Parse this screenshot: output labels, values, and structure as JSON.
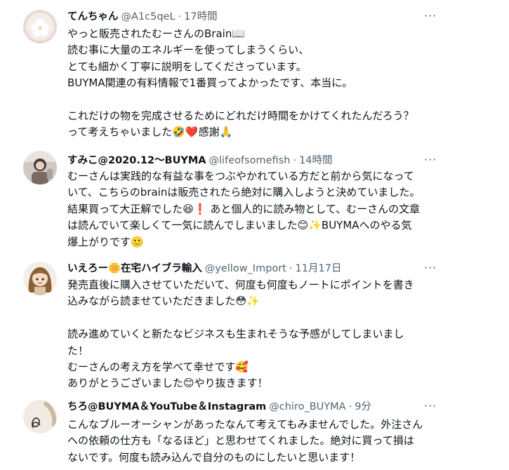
{
  "tweets": [
    {
      "name": "てんちゃん",
      "handle": "@A1c5qeL",
      "time": "17時間",
      "lines": [
        "やっと販売されたむーさんのBrain📖",
        "読む事に大量のエネルギーを使ってしまうくらい、",
        "とても細かく丁寧に説明をしてくださっています。",
        "BUYMA関連の有料情報で1番買ってよかったです、本当に。",
        "",
        "これだけの物を完成させるためにどれだけ時間をかけてくれたんだろう？",
        "って考えちゃいました🤣❤️感謝🙏"
      ]
    },
    {
      "name": "すみこ@2020.12〜BUYMA",
      "handle": "@lifeofsomefish",
      "time": "14時間",
      "lines": [
        "むーさんは実践的な有益な事をつぶやかれている方だと前から気になって",
        "いて、こちらのbrainは販売されたら絶対に購入しようと決めていました。",
        "結果買って大正解でした😆❗ あと個人的に読み物として、むーさんの文章",
        "は読んでいて楽しくて一気に読んでしまいました😊✨BUYMAへのやる気",
        "爆上がりです🙂"
      ]
    },
    {
      "name": "いえろー🌼在宅ハイブラ輸入",
      "handle": "@yellow_Import",
      "time": "11月17日",
      "lines": [
        "発売直後に購入させていただいて、何度も何度もノートにポイントを書き",
        "込みながら読ませていただきました😳✨",
        "",
        "読み進めていくと新たなビジネスも生まれそうな予感がしてしまいまし",
        "た！",
        "むーさんの考え方を学べて幸せです🥰",
        "ありがとうございました😊やり抜きます！"
      ]
    },
    {
      "name": "ちろ@BUYMA＆YouTube＆Instagram",
      "handle": "@chiro_BUYMA",
      "time": "9分",
      "lines": [
        "こんなブルーオーシャンがあったなんて考えてもみませんでした。外注さん",
        "への依頼の仕方も「なるほど」と思わせてくれました。絶対に買って損は",
        "ないです。何度も読み込んで自分のものにしたいと思います！"
      ]
    }
  ],
  "more_icon": "ellipsis-icon",
  "separator": "·"
}
